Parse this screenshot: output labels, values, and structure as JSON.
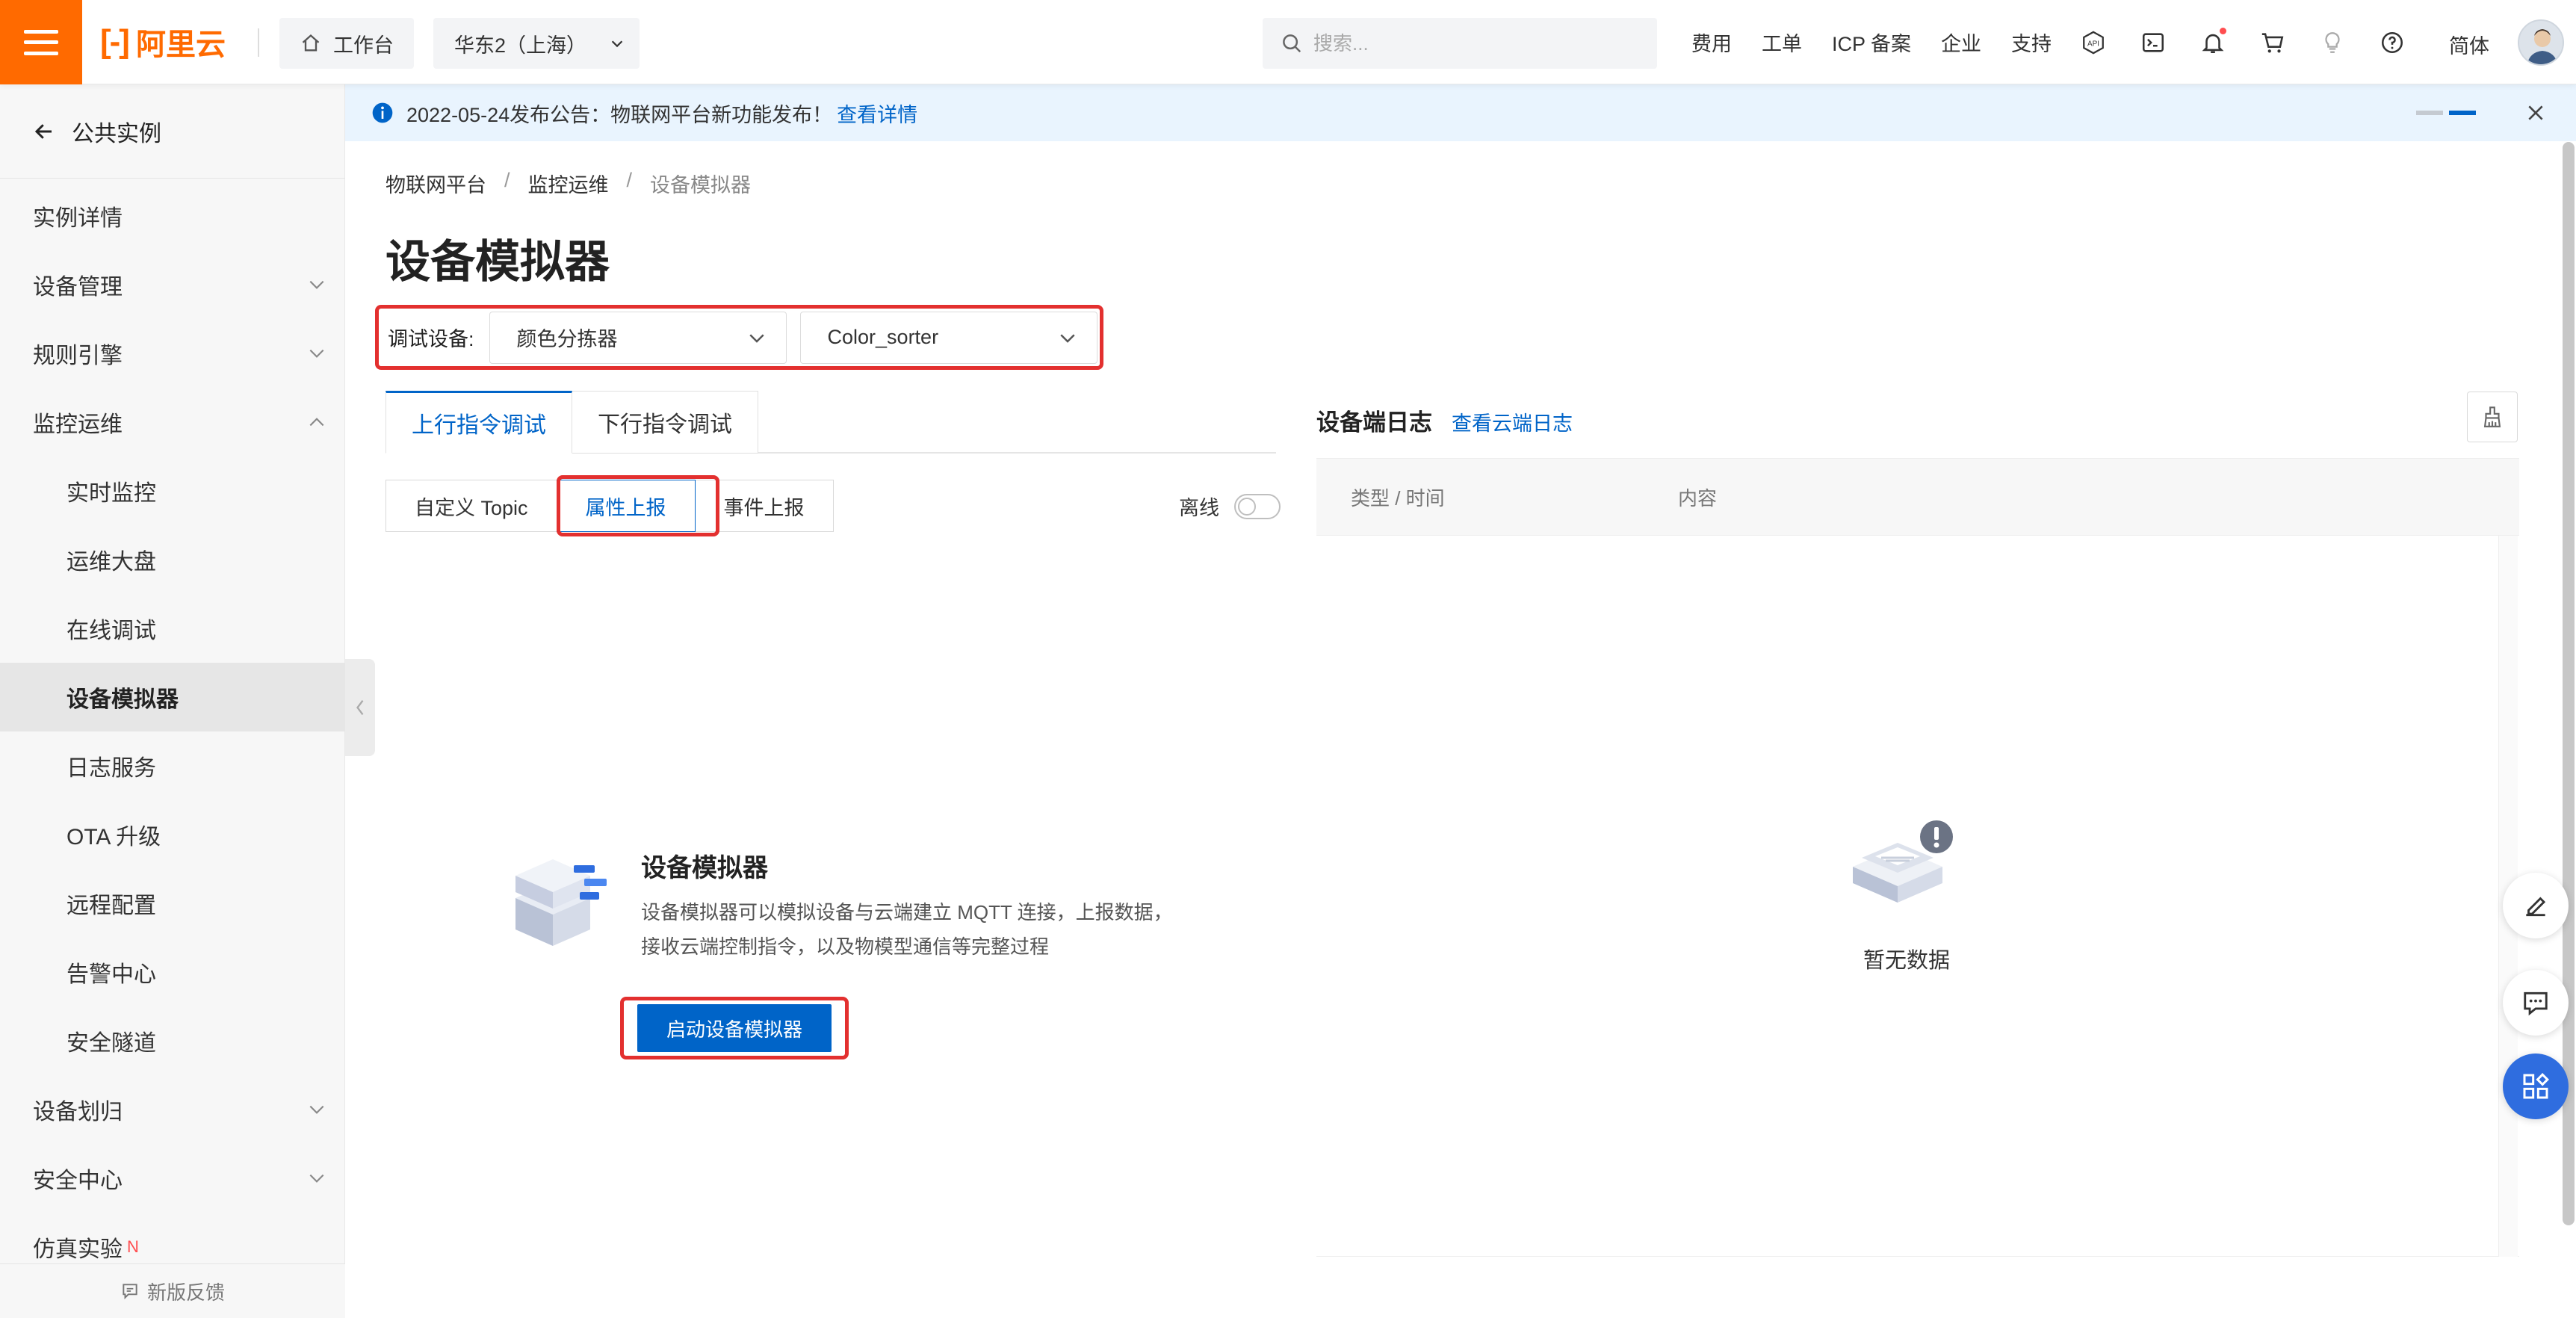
{
  "header": {
    "brand": "阿里云",
    "workbench": "工作台",
    "region": "华东2（上海）",
    "search_placeholder": "搜索...",
    "links": [
      "费用",
      "工单",
      "ICP 备案",
      "企业",
      "支持"
    ],
    "language": "简体",
    "colors": {
      "brand": "#ff6a00",
      "primary": "#0064c8"
    }
  },
  "sidebar": {
    "back_label": "公共实例",
    "items": [
      {
        "label": "实例详情",
        "sub": false,
        "chevron": ""
      },
      {
        "label": "设备管理",
        "sub": false,
        "chevron": "down"
      },
      {
        "label": "规则引擎",
        "sub": false,
        "chevron": "down"
      },
      {
        "label": "监控运维",
        "sub": false,
        "chevron": "up"
      },
      {
        "label": "实时监控",
        "sub": true,
        "chevron": ""
      },
      {
        "label": "运维大盘",
        "sub": true,
        "chevron": ""
      },
      {
        "label": "在线调试",
        "sub": true,
        "chevron": ""
      },
      {
        "label": "设备模拟器",
        "sub": true,
        "chevron": "",
        "active": true
      },
      {
        "label": "日志服务",
        "sub": true,
        "chevron": ""
      },
      {
        "label": "OTA 升级",
        "sub": true,
        "chevron": ""
      },
      {
        "label": "远程配置",
        "sub": true,
        "chevron": ""
      },
      {
        "label": "告警中心",
        "sub": true,
        "chevron": ""
      },
      {
        "label": "安全隧道",
        "sub": true,
        "chevron": ""
      },
      {
        "label": "设备划归",
        "sub": false,
        "chevron": "down"
      },
      {
        "label": "安全中心",
        "sub": false,
        "chevron": "down"
      },
      {
        "label": "仿真实验",
        "sub": false,
        "chevron": "",
        "badge": "N"
      }
    ],
    "feedback": "新版反馈"
  },
  "notice": {
    "text": "2022-05-24发布公告：物联网平台新功能发布！",
    "link": "查看详情"
  },
  "breadcrumb": [
    "物联网平台",
    "监控运维",
    "设备模拟器"
  ],
  "page_title": "设备模拟器",
  "selector": {
    "label": "调试设备:",
    "product": "颜色分拣器",
    "device": "Color_sorter"
  },
  "tabs": [
    {
      "label": "上行指令调试",
      "active": true
    },
    {
      "label": "下行指令调试",
      "active": false
    }
  ],
  "segments": [
    {
      "label": "自定义 Topic",
      "active": false
    },
    {
      "label": "属性上报",
      "active": true
    },
    {
      "label": "事件上报",
      "active": false
    }
  ],
  "offline_label": "离线",
  "simulator_empty": {
    "title": "设备模拟器",
    "description": "设备模拟器可以模拟设备与云端建立 MQTT 连接，上报数据，接收云端控制指令，以及物模型通信等完整过程",
    "start_button": "启动设备模拟器"
  },
  "device_log": {
    "title": "设备端日志",
    "link": "查看云端日志",
    "columns": [
      "类型 / 时间",
      "内容"
    ],
    "empty_text": "暂无数据"
  }
}
